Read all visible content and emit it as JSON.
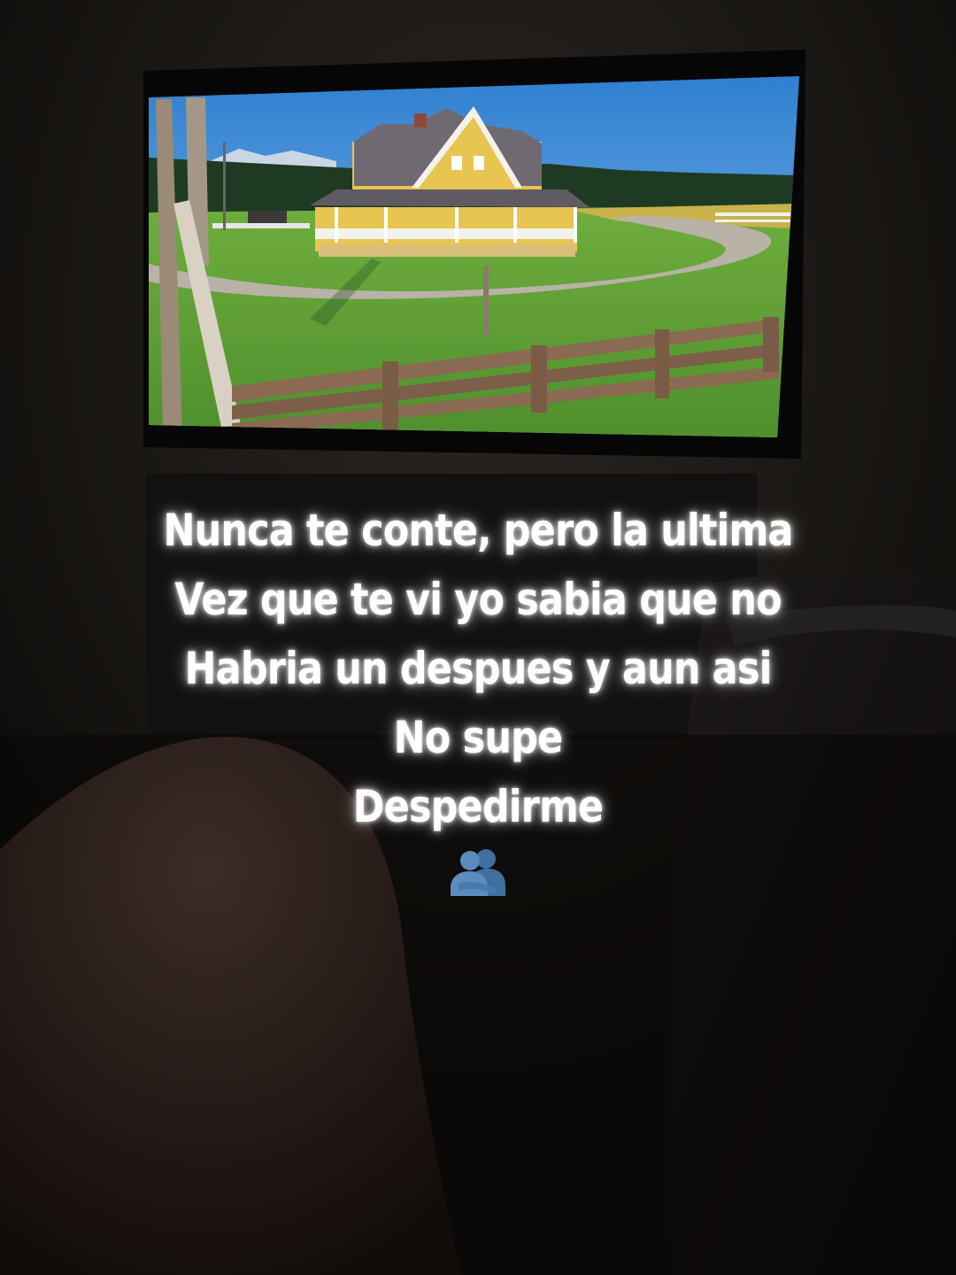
{
  "caption": {
    "lines": [
      "Nunca te conte, pero la ultima",
      "Vez que te vi yo sabia que no",
      "Habria un despues y aun asi",
      "No supe",
      "Despedirme"
    ],
    "emoji": "people-hugging"
  },
  "scene": {
    "subject": "television showing a yellow farmhouse with wraparound porch, gravel driveway, green field and wooden fence",
    "colors": {
      "room": "#0f0d0b",
      "wall": "#1a1714",
      "sky": "#3f8fd6",
      "grass": "#5fa03a",
      "house": "#e8c451",
      "roof": "#6f6a72",
      "fence": "#8a6a52",
      "caption": "#ffffff",
      "emoji": "#4a78a8"
    }
  }
}
